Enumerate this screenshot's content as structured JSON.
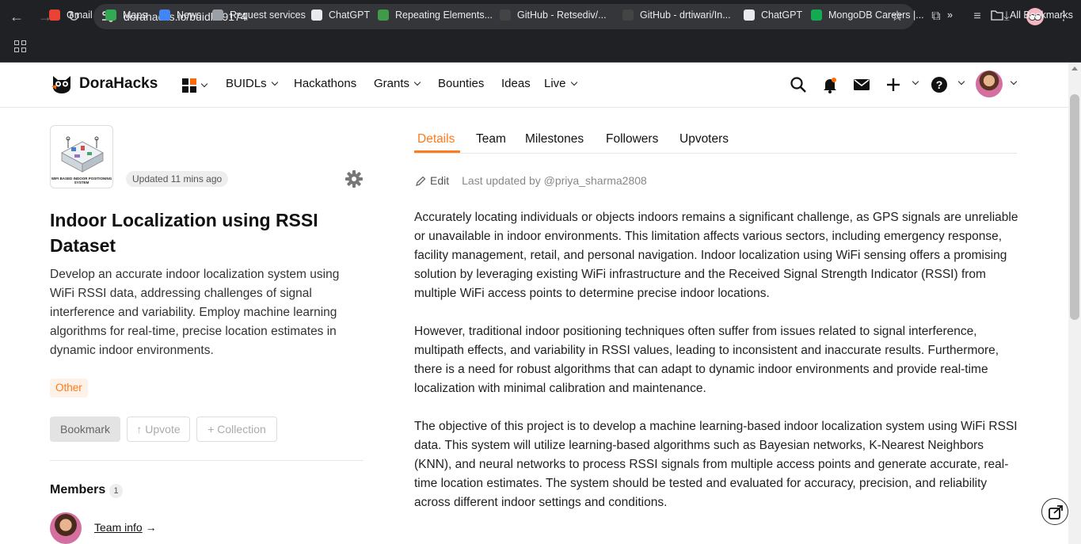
{
  "browser": {
    "url": "dorahacks.io/buidl/19174",
    "bookmarks": [
      {
        "label": "Gmail",
        "color": "#ea4335"
      },
      {
        "label": "Maps",
        "color": "#34a853"
      },
      {
        "label": "News",
        "color": "#4285f4"
      },
      {
        "label": "Request services",
        "color": "#9aa0a6"
      },
      {
        "label": "ChatGPT",
        "color": "#e8eaed"
      },
      {
        "label": "Repeating Elements...",
        "color": "#3f9a4a"
      },
      {
        "label": "GitHub - Retsediv/...",
        "color": "#444"
      },
      {
        "label": "GitHub - drtiwari/In...",
        "color": "#444"
      },
      {
        "label": "ChatGPT",
        "color": "#e8eaed"
      },
      {
        "label": "MongoDB Careers |...",
        "color": "#13aa52"
      }
    ],
    "all_bookmarks": "All Bookmarks",
    "more": "»"
  },
  "header": {
    "brand": "DoraHacks",
    "nav": [
      "BUIDLs",
      "Hackathons",
      "Grants",
      "Bounties",
      "Ideas",
      "Live"
    ]
  },
  "project": {
    "updated": "Updated 11 mins ago",
    "thumb_caption": "WIFI BASED INDOOR POSITIONING SYSTEM",
    "title": "Indoor Localization using RSSI Dataset",
    "description": "Develop an accurate indoor localization system using WiFi RSSI data, addressing challenges of signal interference and variability. Employ machine learning algorithms for real-time, precise location estimates in dynamic indoor environments.",
    "tag": "Other",
    "buttons": {
      "bookmark": "Bookmark",
      "upvote": "↑ Upvote",
      "collection": "+ Collection"
    },
    "members_label": "Members",
    "members_count": "1",
    "team_info": "Team info",
    "team_arrow": "→"
  },
  "tabs": [
    "Details",
    "Team",
    "Milestones",
    "Followers",
    "Upvoters"
  ],
  "details": {
    "edit": "Edit",
    "last_updated": "Last updated by @priya_sharma2808",
    "paragraphs": [
      "Accurately locating individuals or objects indoors remains a significant challenge, as GPS signals are unreliable or unavailable in indoor environments. This limitation affects various sectors, including emergency response, facility management, retail, and personal navigation. Indoor localization using WiFi sensing offers a promising solution by leveraging existing WiFi infrastructure and the Received Signal Strength Indicator (RSSI) from multiple WiFi access points to determine precise indoor locations.",
      "However, traditional indoor positioning techniques often suffer from issues related to signal interference, multipath effects, and variability in RSSI values, leading to inconsistent and inaccurate results. Furthermore, there is a need for robust algorithms that can adapt to dynamic indoor environments and provide real-time localization with minimal calibration and maintenance.",
      "The objective of this project is to develop a machine learning-based indoor localization system using WiFi RSSI data. This system will utilize learning-based algorithms such as Bayesian networks, K-Nearest Neighbors (KNN), and neural networks to process RSSI signals from multiple access points and generate accurate, real-time location estimates. The system should be tested and evaluated for accuracy, precision, and reliability across different indoor settings and conditions."
    ]
  },
  "colors": {
    "accent": "#ff7a1a",
    "chrome": "#202124"
  }
}
